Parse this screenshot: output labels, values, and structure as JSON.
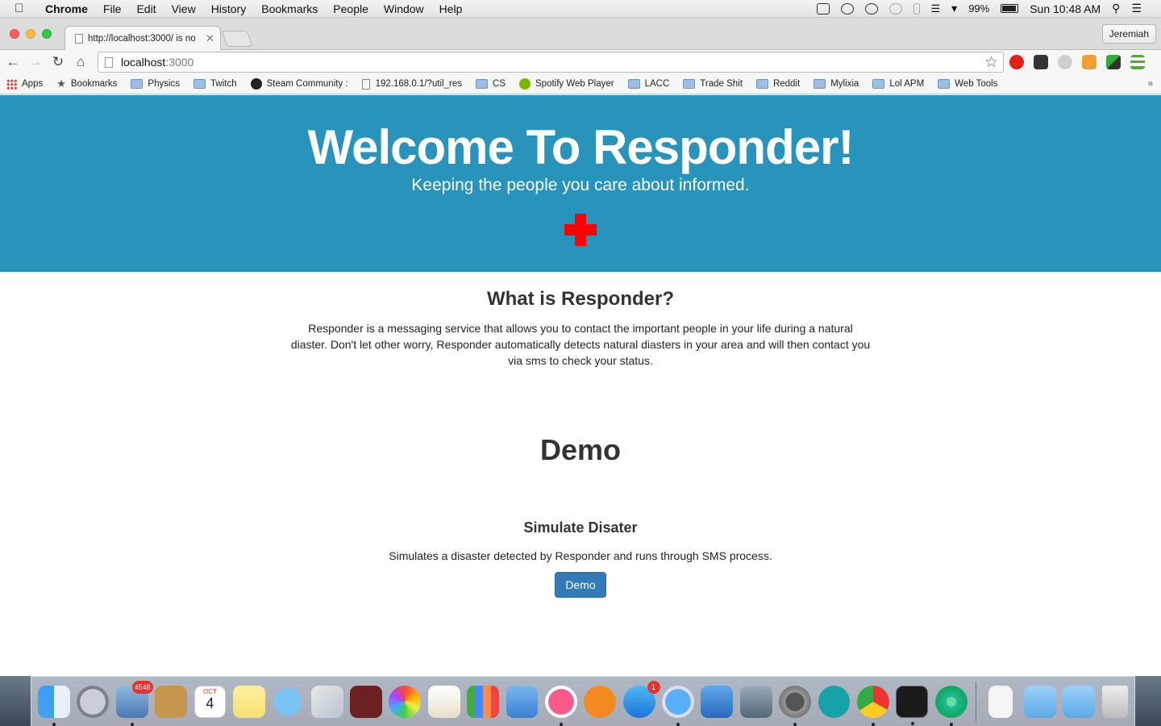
{
  "menubar": {
    "app": "Chrome",
    "items": [
      "File",
      "Edit",
      "View",
      "History",
      "Bookmarks",
      "People",
      "Window",
      "Help"
    ],
    "battery": "99%",
    "clock": "Sun 10:48 AM"
  },
  "browser": {
    "tab_title": "http://localhost:3000/ is no",
    "profile": "Jeremiah",
    "url_host": "localhost",
    "url_port": ":3000",
    "bookmarks": [
      "Apps",
      "Bookmarks",
      "Physics",
      "Twitch",
      "Steam Community :",
      "192.168.0.1/?util_res",
      "CS",
      "Spotify Web Player",
      "LACC",
      "Trade Shit",
      "Reddit",
      "Mylixia",
      "Lol APM",
      "Web Tools"
    ],
    "bookmarks_more": "»"
  },
  "hero": {
    "title": "Welcome To Responder!",
    "subtitle": "Keeping the people you care about informed."
  },
  "about": {
    "heading": "What is Responder?",
    "body": "Responder is a messaging service that allows you to contact the important people in your life during a natural diaster. Don't let other worry, Responder automatically detects natural diasters in your area and will then contact you via sms to check your status."
  },
  "demo": {
    "heading": "Demo",
    "subheading": "Simulate Disater",
    "description": "Simulates a disaster detected by Responder and runs through SMS process.",
    "button_label": "Demo"
  },
  "dock": {
    "mail_badge": "4548",
    "calendar_month": "OCT",
    "calendar_day": "4",
    "appstore_badge": "1"
  },
  "colors": {
    "hero_bg": "#2893bb",
    "button_bg": "#337ab7",
    "cross": "#ff0000"
  }
}
